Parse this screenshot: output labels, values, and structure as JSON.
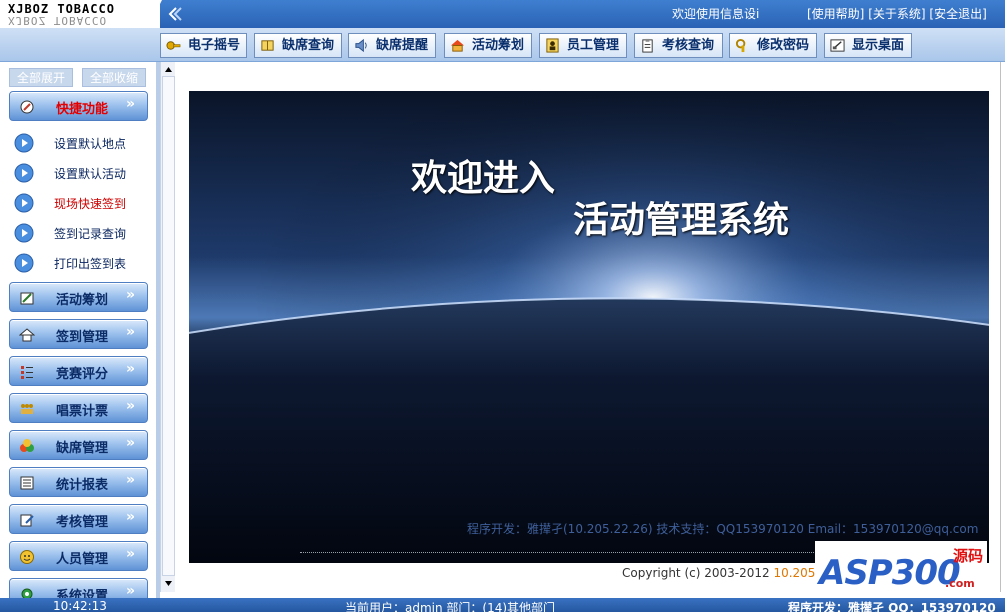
{
  "header": {
    "logo_text": "XJBOZ TOBACCO",
    "welcome": "欢迎使用信息设i",
    "links": [
      "[使用帮助]",
      "[关于系统]",
      "[安全退出]"
    ]
  },
  "toolbar": [
    {
      "label": "电子摇号",
      "icon": "key-icon"
    },
    {
      "label": "缺席查询",
      "icon": "book-icon"
    },
    {
      "label": "缺席提醒",
      "icon": "speaker-icon"
    },
    {
      "label": "活动筹划",
      "icon": "house-icon"
    },
    {
      "label": "员工管理",
      "icon": "person-icon"
    },
    {
      "label": "考核查询",
      "icon": "clipboard-icon"
    },
    {
      "label": "修改密码",
      "icon": "lock-icon"
    },
    {
      "label": "显示桌面",
      "icon": "desktop-icon"
    }
  ],
  "sidebar": {
    "expand_all": "全部展开",
    "collapse_all": "全部收缩",
    "quick": {
      "label": "快捷功能",
      "items": [
        "设置默认地点",
        "设置默认活动",
        "现场快速签到",
        "签到记录查询",
        "打印出签到表"
      ]
    },
    "categories": [
      "活动筹划",
      "签到管理",
      "竞赛评分",
      "唱票计票",
      "缺席管理",
      "统计报表",
      "考核管理",
      "人员管理",
      "系统设置"
    ]
  },
  "banner": {
    "title_line1": "欢迎进入",
    "title_line2": "活动管理系统",
    "credit": "程序开发：雅撵孑(10.205.22.26)   技术支持：QQ153970120 Email：153970120@qq.com"
  },
  "footer": {
    "copyright": "Copyright (c) 2003-2012 ",
    "copyright_ip": "10.205.22.26"
  },
  "watermark": {
    "text": "ASP300",
    "cn": "源码",
    "com": ".com"
  },
  "statusbar": {
    "time": "10:42:13",
    "user": "当前用户：admin    部门：(14)其他部门",
    "dev": "程序开发：雅撵孑  QQ：153970120"
  },
  "colors": {
    "header_blue": "#2a63b6",
    "active_red": "#e40000"
  }
}
